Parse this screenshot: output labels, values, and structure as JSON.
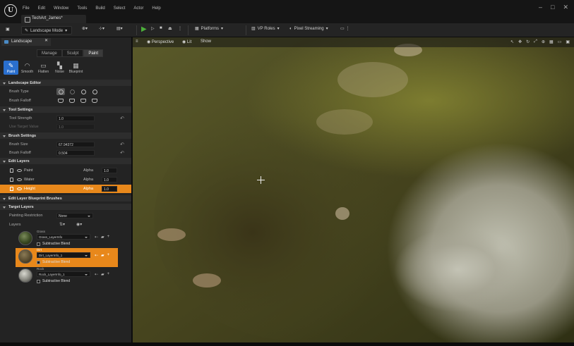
{
  "menu": {
    "items": [
      "File",
      "Edit",
      "Window",
      "Tools",
      "Build",
      "Select",
      "Actor",
      "Help"
    ]
  },
  "project": {
    "tab": "TechArt_James*"
  },
  "toolbar": {
    "mode": "Landscape Mode",
    "platforms": "Platforms",
    "vp_roles": "VP Roles",
    "pixel_streaming": "Pixel Streaming"
  },
  "panel": {
    "title": "Landscape",
    "mode_tabs": [
      "Manage",
      "Sculpt",
      "Paint"
    ],
    "tools": [
      "Paint",
      "Smooth",
      "Flatten",
      "Noise",
      "Blueprint"
    ],
    "sections": {
      "landscape_editor": "Landscape Editor",
      "tool_settings": "Tool Settings",
      "brush_settings": "Brush Settings",
      "edit_layers": "Edit Layers",
      "edit_layer_blueprint": "Edit Layer Blueprint Brushes",
      "target_layers": "Target Layers"
    },
    "brush_type_label": "Brush Type",
    "brush_falloff_label": "Brush Falloff",
    "tool_strength_label": "Tool Strength",
    "tool_strength_value": "1.0",
    "use_target_value_label": "Use Target Value",
    "use_target_value": "1.0",
    "brush_size_label": "Brush Size",
    "brush_size_value": "67.94372",
    "brush_falloff_value_label": "Brush Falloff",
    "brush_falloff_value": "0.504",
    "edit_layers": [
      {
        "name": "Paint",
        "alpha_label": "Alpha",
        "alpha": "1.0"
      },
      {
        "name": "Water",
        "alpha_label": "Alpha",
        "alpha": "1.0"
      },
      {
        "name": "Height",
        "alpha_label": "Alpha",
        "alpha": "1.0"
      }
    ],
    "painting_restriction_label": "Painting Restriction",
    "painting_restriction": "None",
    "layers_label": "Layers",
    "layers": [
      {
        "name": "Grass",
        "info": "Grass_LayerInfo",
        "blend": "Subtractive Blend"
      },
      {
        "name": "Dirt",
        "info": "Dirt_LayerInfo_1",
        "blend": "Subtractive Blend"
      },
      {
        "name": "Rock",
        "info": "Rock_LayerInfo_1",
        "blend": "Subtractive Blend"
      }
    ]
  },
  "viewport": {
    "perspective": "Perspective",
    "lit": "Lit",
    "show": "Show"
  }
}
